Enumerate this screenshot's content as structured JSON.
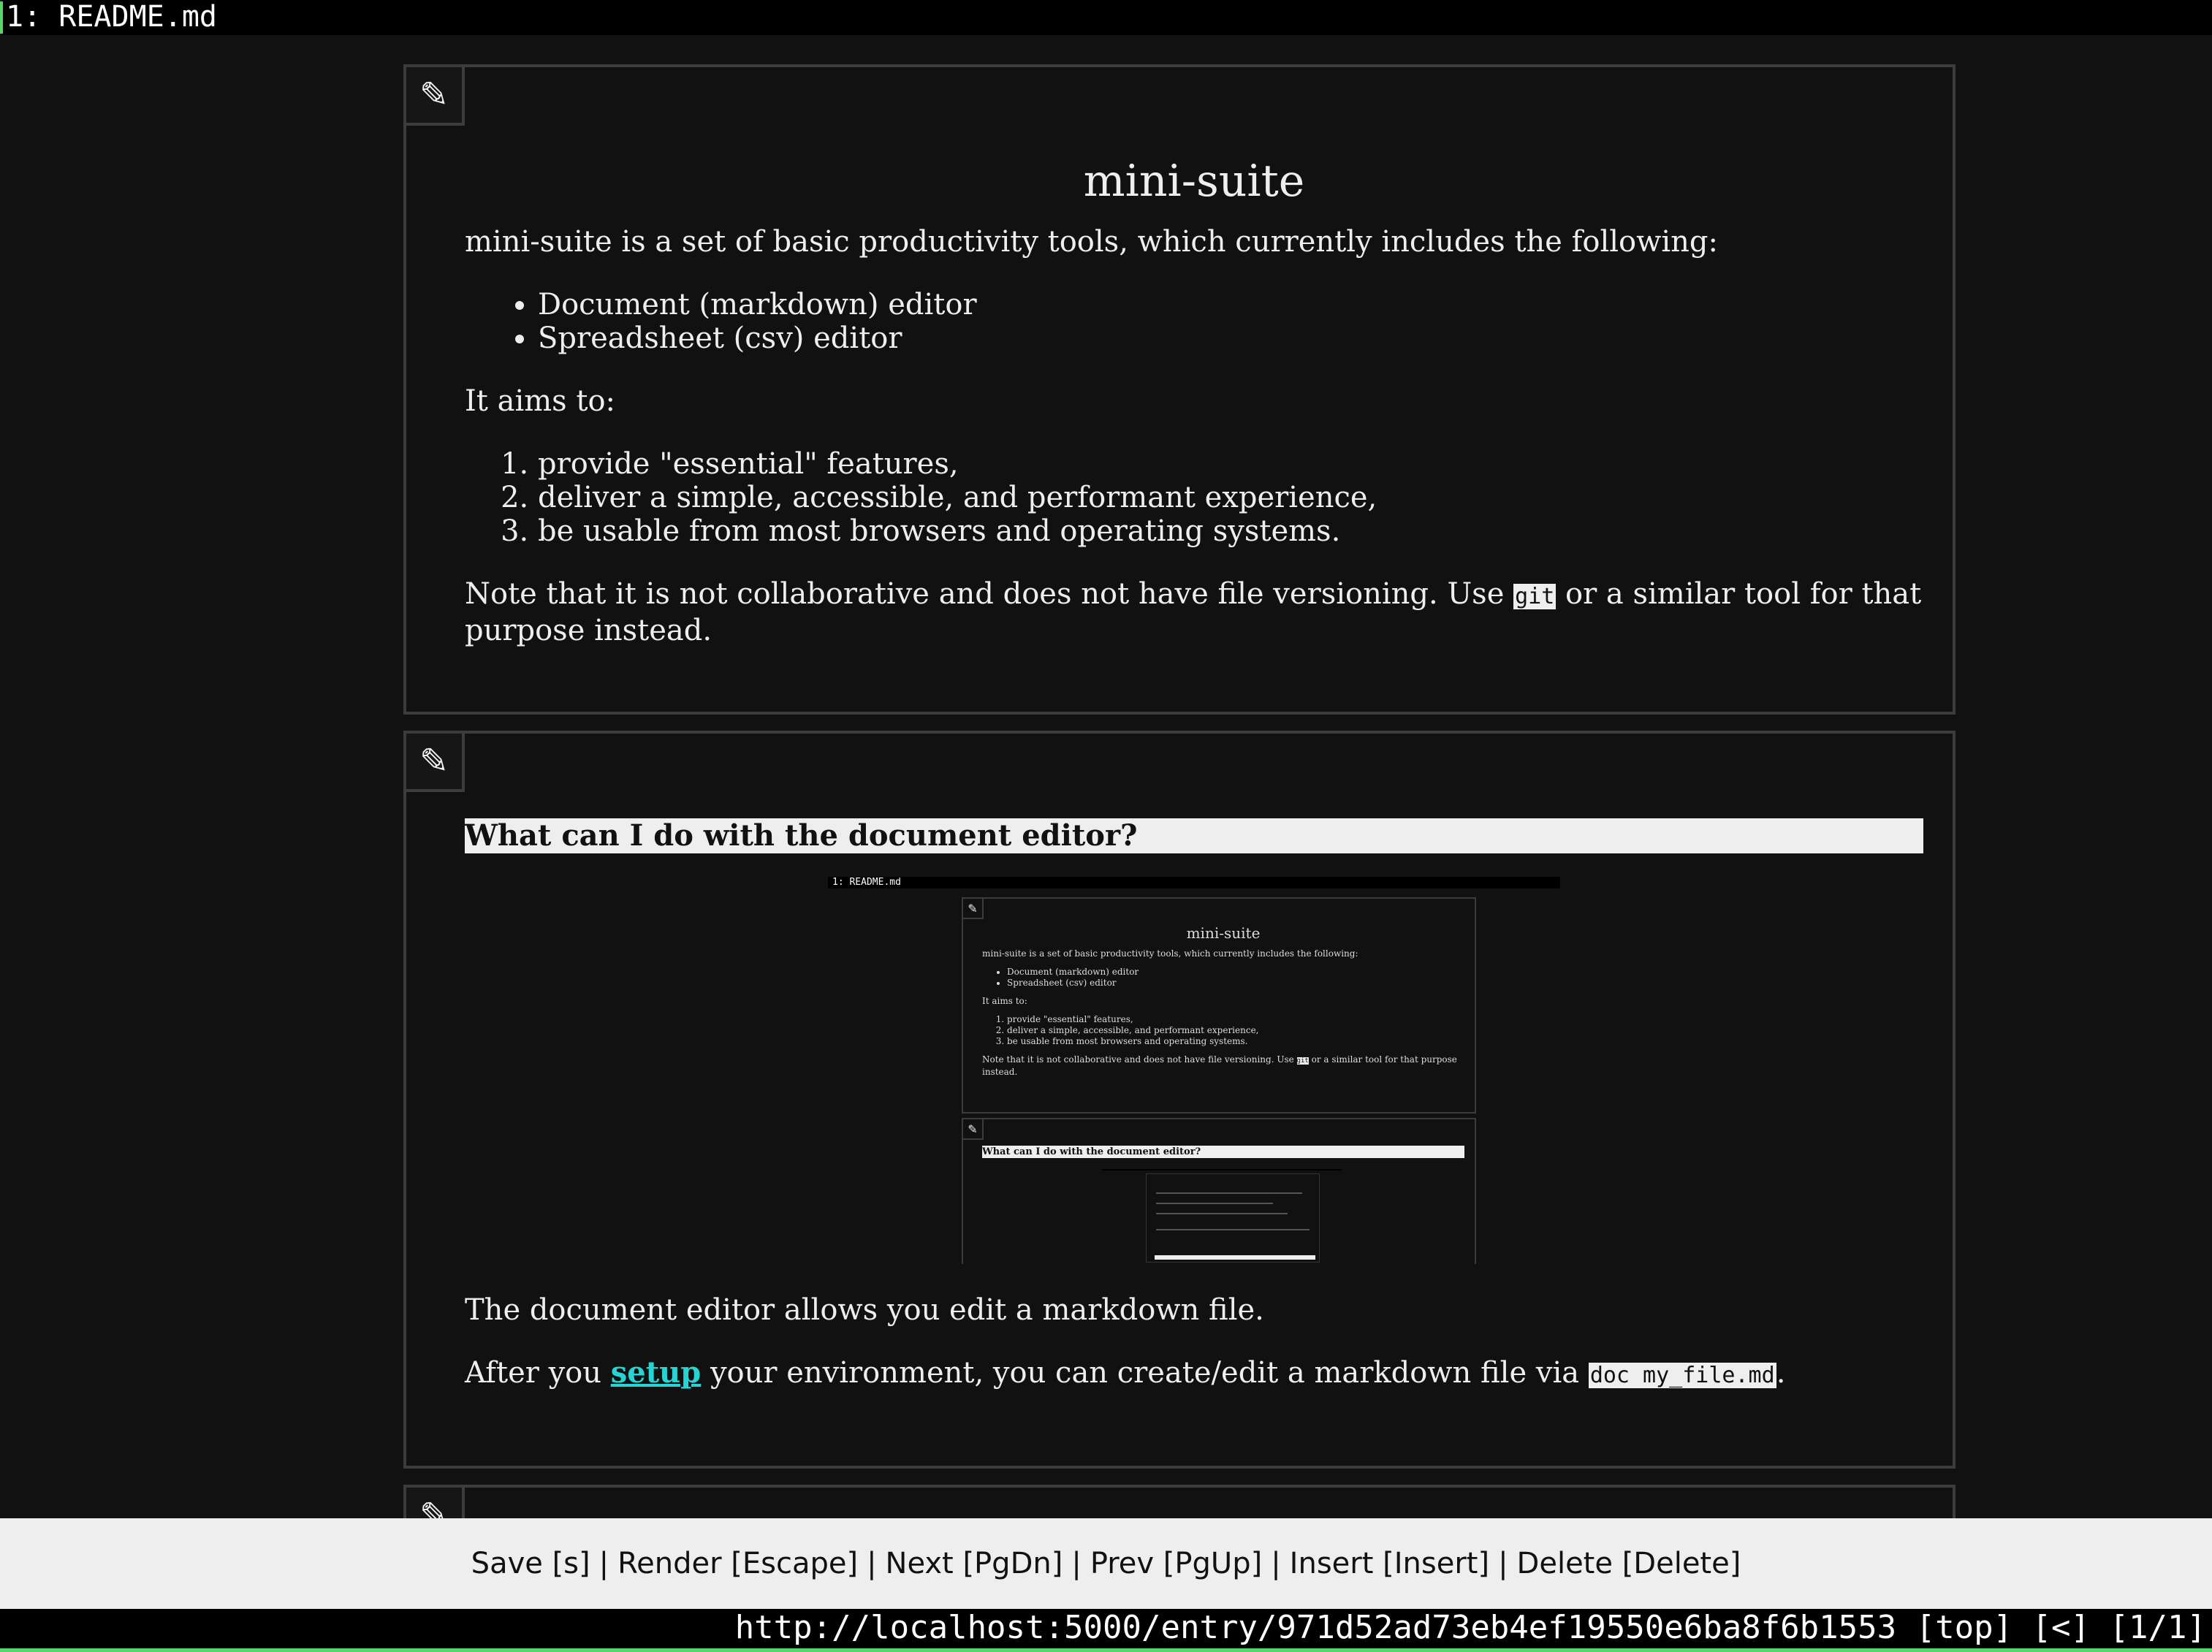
{
  "tab": {
    "label": "1: README.md"
  },
  "blocks": [
    {
      "edit_icon": "✎",
      "title": "mini-suite",
      "intro": "mini-suite is a set of basic productivity tools, which currently includes the following:",
      "bullets": [
        "Document (markdown) editor",
        "Spreadsheet (csv) editor"
      ],
      "aims_label": "It aims to:",
      "aims": [
        "provide \"essential\" features,",
        "deliver a simple, accessible, and performant experience,",
        "be usable from most browsers and operating systems."
      ],
      "note_before": "Note that it is not collaborative and does not have file versioning. Use ",
      "note_code": "git",
      "note_after": " or a similar tool for that purpose instead."
    },
    {
      "edit_icon": "✎",
      "heading": "What can I do with the document editor?",
      "para1": "The document editor allows you edit a markdown file.",
      "para2_before": "After you ",
      "para2_link": "setup",
      "para2_middle": " your environment, you can create/edit a markdown file via ",
      "para2_code": "doc my_file.md",
      "para2_after": "."
    },
    {
      "edit_icon": "✎"
    }
  ],
  "help": {
    "items": [
      "Save [s]",
      "Render [Escape]",
      "Next [PgDn]",
      "Prev [PgUp]",
      "Insert [Insert]",
      "Delete [Delete]"
    ],
    "separator": "|"
  },
  "status": {
    "url": "http://localhost:5000/entry/971d52ad73eb4ef19550e6ba8f6b1553",
    "position": "[top]",
    "nav": "[<]",
    "page": "[1/1]"
  },
  "colors": {
    "background": "#111111",
    "border": "#3c3c3c",
    "text": "#eeeeee",
    "link": "#29d3d3",
    "accent_green": "#55d66b",
    "help_bg": "#eeeeee"
  }
}
